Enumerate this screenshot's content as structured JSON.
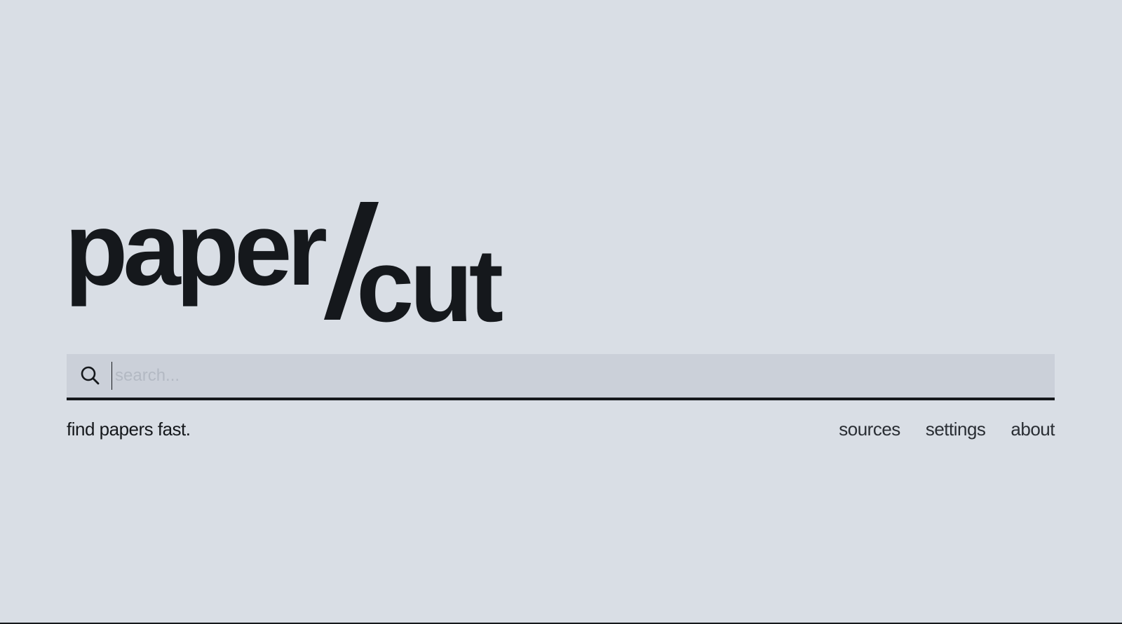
{
  "logo": {
    "left_word": "paper",
    "right_word": "cut"
  },
  "search": {
    "placeholder": "search...",
    "value": "",
    "icon": "search-icon"
  },
  "tagline": "find papers fast.",
  "nav": {
    "sources": "sources",
    "settings": "settings",
    "about": "about"
  },
  "colors": {
    "background": "#d9dee5",
    "search_background": "#cbd0d9",
    "text": "#15181c"
  }
}
